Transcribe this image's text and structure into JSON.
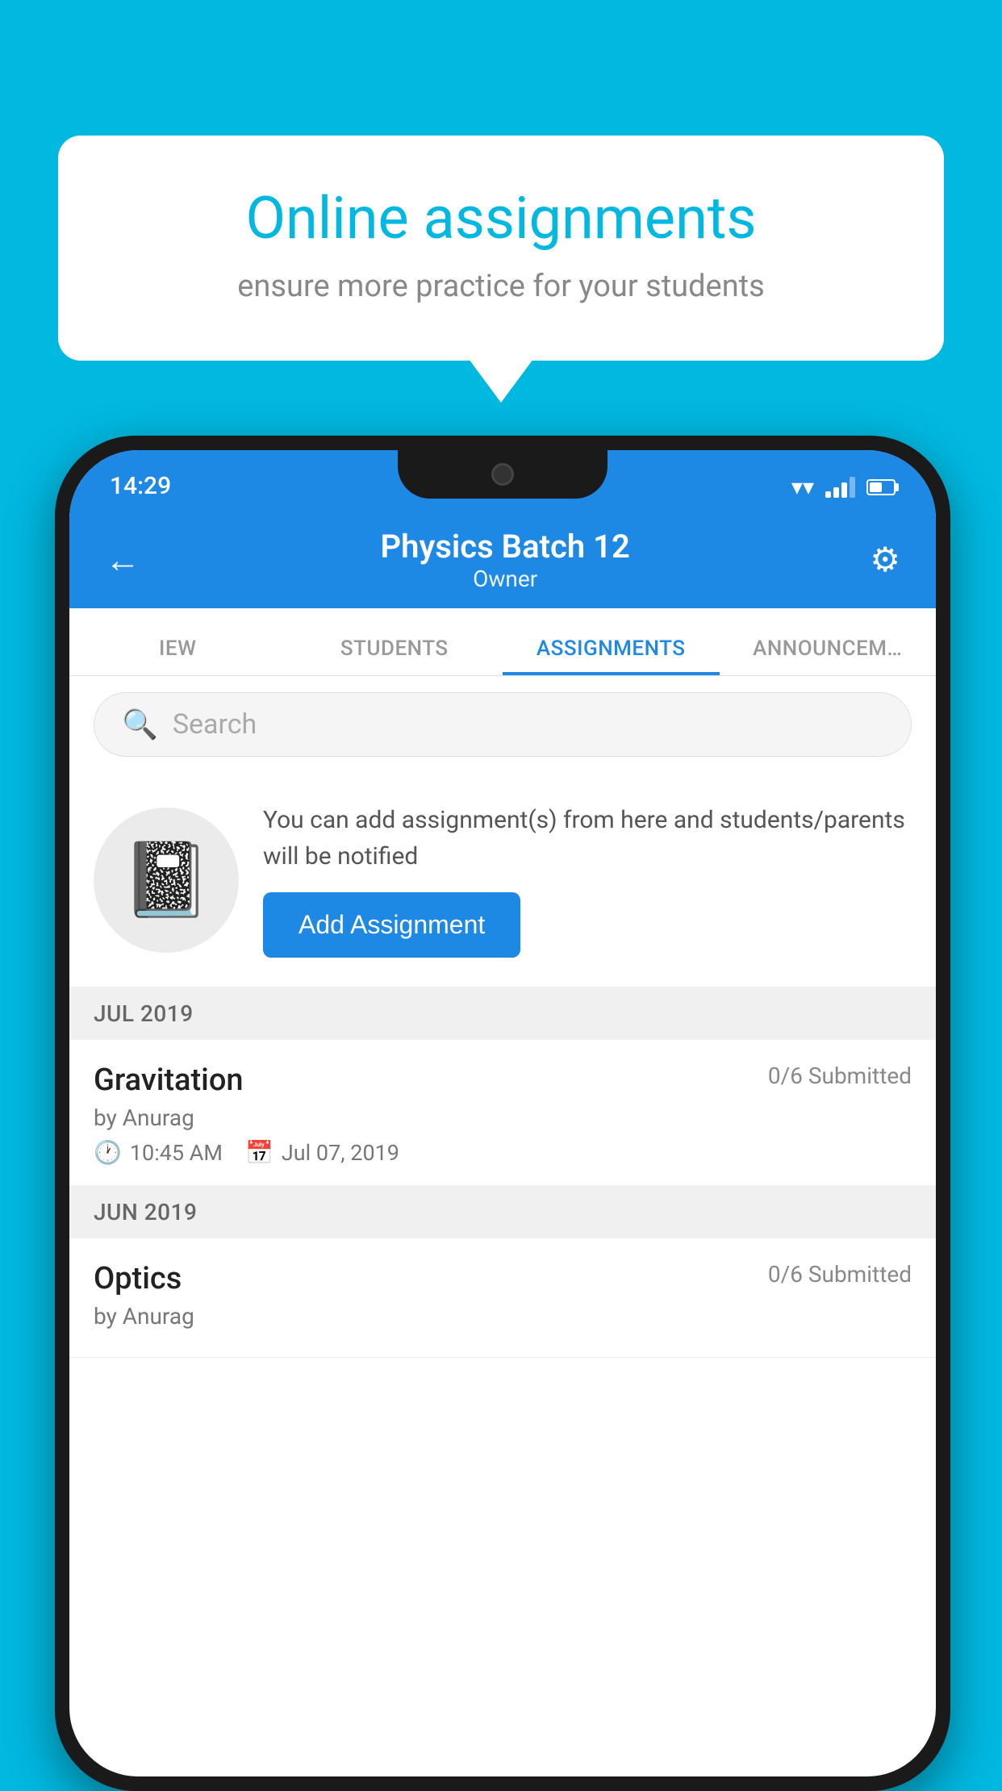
{
  "background_color": "#00b8e0",
  "speech_bubble": {
    "title": "Online assignments",
    "subtitle": "ensure more practice for your students"
  },
  "phone": {
    "status_bar": {
      "time": "14:29"
    },
    "header": {
      "title": "Physics Batch 12",
      "subtitle": "Owner",
      "back_label": "←",
      "settings_label": "⚙"
    },
    "tabs": [
      {
        "label": "IEW",
        "active": false
      },
      {
        "label": "STUDENTS",
        "active": false
      },
      {
        "label": "ASSIGNMENTS",
        "active": true
      },
      {
        "label": "ANNOUNCEM…",
        "active": false
      }
    ],
    "search": {
      "placeholder": "Search"
    },
    "promo": {
      "description": "You can add assignment(s) from here and students/parents will be notified",
      "button_label": "Add Assignment"
    },
    "sections": [
      {
        "month": "JUL 2019",
        "assignments": [
          {
            "title": "Gravitation",
            "submitted": "0/6 Submitted",
            "author": "by Anurag",
            "time": "10:45 AM",
            "date": "Jul 07, 2019"
          }
        ]
      },
      {
        "month": "JUN 2019",
        "assignments": [
          {
            "title": "Optics",
            "submitted": "0/6 Submitted",
            "author": "by Anurag",
            "time": "",
            "date": ""
          }
        ]
      }
    ]
  }
}
